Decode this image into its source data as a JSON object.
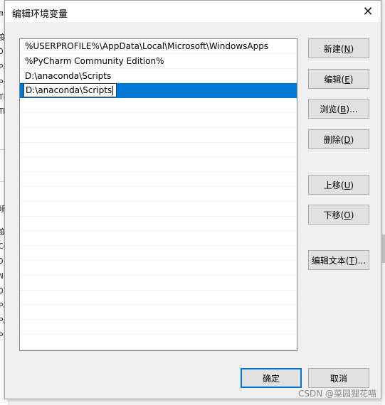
{
  "dialog": {
    "title": "编辑环境变量",
    "close_glyph": "✕"
  },
  "list": {
    "items": [
      "%USERPROFILE%\\AppData\\Local\\Microsoft\\WindowsApps",
      "%PyCharm Community Edition%",
      "D:\\anaconda\\Scripts"
    ],
    "editing_value": "D:\\anaconda\\Scripts",
    "selected_color": "#0078d7"
  },
  "buttons": {
    "new_label": "新建(",
    "new_key": "N",
    "edit_label": "编辑(",
    "edit_key": "E",
    "browse_label": "浏览(",
    "browse_key": "B",
    "browse_suffix": ")...",
    "delete_label": "删除(",
    "delete_key": "D",
    "move_up_label": "上移(",
    "move_up_key": "U",
    "move_down_label": "下移(",
    "move_down_key": "O",
    "edit_text_label": "编辑文本(",
    "edit_text_key": "T",
    "edit_text_suffix": ")...",
    "close_paren": ")",
    "ok_label": "确定",
    "cancel_label": "取消"
  },
  "background": {
    "left_chars": [
      "m",
      "变",
      "O",
      "Pa",
      "Py",
      "TE",
      "TM",
      "境",
      "变",
      "Co",
      "Dr",
      "N",
      "O",
      "Pa",
      "PA",
      "PF"
    ]
  },
  "watermark": "CSDN @菜园狸花喵"
}
